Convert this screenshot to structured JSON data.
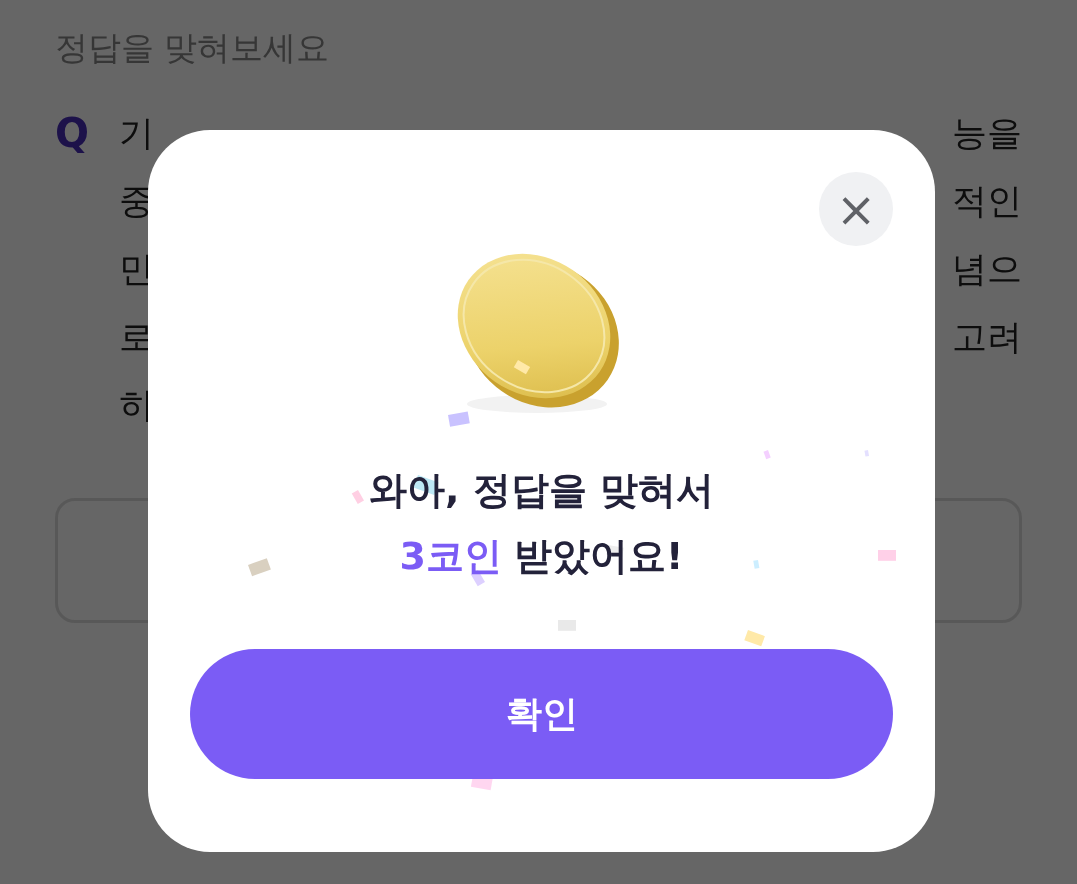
{
  "page": {
    "title": "정답을 맞혀보세요",
    "question_mark": "Q",
    "question_lines": [
      {
        "left": "기",
        "right": "능을"
      },
      {
        "left": "중",
        "right": "적인"
      },
      {
        "left": "민",
        "right": "념으"
      },
      {
        "left": "로",
        "right": "고려"
      },
      {
        "left": "히"
      }
    ]
  },
  "dialog": {
    "close": "×",
    "message_line": "와아, 정답을 맞혀서",
    "reward": "3코인",
    "message_rest": "받았어요!",
    "confirm_button": "확인"
  }
}
